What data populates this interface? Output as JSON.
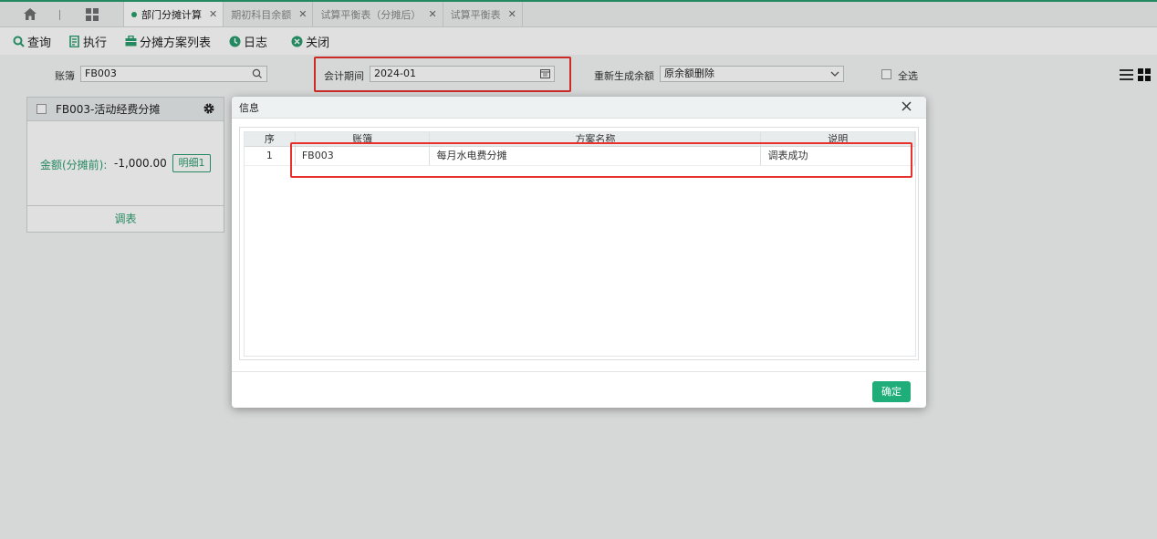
{
  "tabs": [
    {
      "label": "部门分摊计算",
      "active": true
    },
    {
      "label": "期初科目余额",
      "active": false
    },
    {
      "label": "试算平衡表（分摊后）",
      "active": false
    },
    {
      "label": "试算平衡表",
      "active": false
    }
  ],
  "toolbar": {
    "query": "查询",
    "execute": "执行",
    "plan_list": "分摊方案列表",
    "log": "日志",
    "close": "关闭"
  },
  "filters": {
    "account_label": "账簿",
    "account_value": "FB003",
    "period_label": "会计期间",
    "period_value": "2024-01",
    "regen_label": "重新生成余额",
    "regen_value": "原余额删除",
    "select_all_label": "全选"
  },
  "card": {
    "title": "FB003-活动经费分摊",
    "amount_label": "金额(分摊前):",
    "amount_value": "-1,000.00",
    "detail_button": "明细1",
    "footer": "调表"
  },
  "dialog": {
    "title": "信息",
    "columns": [
      "序",
      "账簿",
      "方案名称",
      "说明"
    ],
    "rows": [
      {
        "seq": "1",
        "account": "FB003",
        "plan": "每月水电费分摊",
        "note": "调表成功"
      }
    ],
    "ok_button": "确定"
  },
  "colors": {
    "accent": "#2a9d6e",
    "highlight": "#e8302d",
    "ok": "#1fae7a"
  }
}
